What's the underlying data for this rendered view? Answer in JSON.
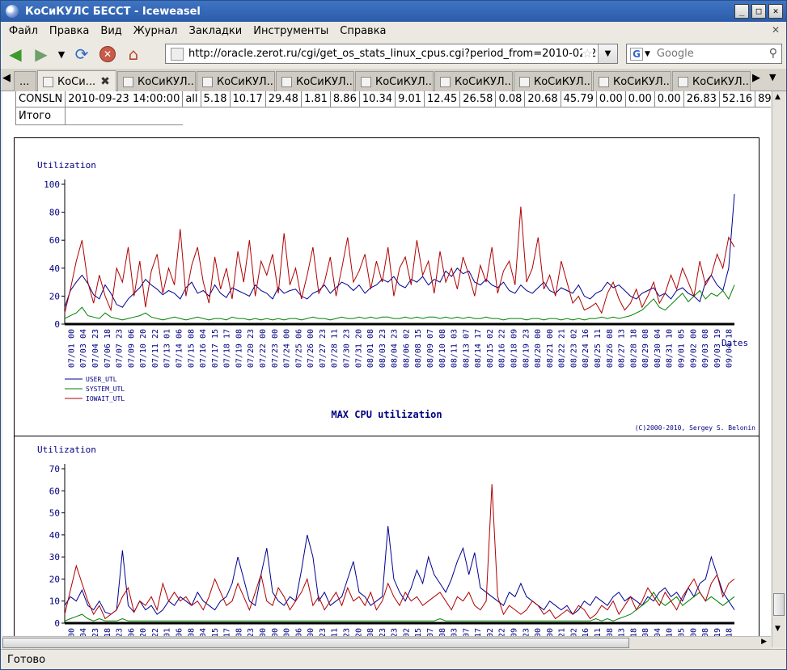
{
  "window": {
    "title": "КоСиКУЛС БЕССТ - Iceweasel",
    "btn_minimize": "_",
    "btn_maximize": "□",
    "btn_close": "✕"
  },
  "menu": [
    "Файл",
    "Правка",
    "Вид",
    "Журнал",
    "Закладки",
    "Инструменты",
    "Справка"
  ],
  "nav": {
    "url": "http://oracle.zerot.ru/cgi/get_os_stats_linux_cpus.cgi?period_from=2010-02-2",
    "search_placeholder": "Google"
  },
  "tabs": [
    {
      "label": "...",
      "active": false
    },
    {
      "label": "КоСи...",
      "active": true
    },
    {
      "label": "КоСиКУЛ...",
      "active": false
    },
    {
      "label": "КоСиКУЛ...",
      "active": false
    },
    {
      "label": "КоСиКУЛ...",
      "active": false
    },
    {
      "label": "КоСиКУЛ...",
      "active": false
    },
    {
      "label": "КоСиКУЛ...",
      "active": false
    },
    {
      "label": "КоСиКУЛ...",
      "active": false
    },
    {
      "label": "КоСиКУЛ...",
      "active": false
    },
    {
      "label": "КоСиКУЛ...",
      "active": false
    }
  ],
  "table": {
    "row": [
      "CONSLN",
      "2010-09-23 14:00:00",
      "all",
      "5.18",
      "10.17",
      "29.48",
      "1.81",
      "8.86",
      "10.34",
      "9.01",
      "12.45",
      "26.58",
      "0.08",
      "20.68",
      "45.79",
      "0.00",
      "0.00",
      "0.00",
      "26.83",
      "52.16",
      "89"
    ],
    "total_label": "Итого"
  },
  "status": "Готово",
  "chart_data": [
    {
      "type": "line",
      "title": "MAX CPU utilization",
      "ylabel": "Utilization",
      "xlabel": "Dates",
      "ylim": [
        0,
        100
      ],
      "yticks": [
        0,
        20,
        40,
        60,
        80,
        100
      ],
      "copyright": "(C)2000-2010, Sergey S. Belonin",
      "x_tick_labels": [
        "07/01 00",
        "07/03 04",
        "07/04 23",
        "07/06 18",
        "07/07 23",
        "07/09 06",
        "07/10 20",
        "07/11 22",
        "07/13 01",
        "07/14 06",
        "07/15 08",
        "07/16 04",
        "07/17 15",
        "07/18 17",
        "07/19 08",
        "07/20 23",
        "07/22 00",
        "07/23 00",
        "07/24 00",
        "07/25 06",
        "07/26 00",
        "07/27 23",
        "07/28 11",
        "07/30 23",
        "07/31 20",
        "08/01 08",
        "08/03 23",
        "08/04 23",
        "08/06 02",
        "08/08 15",
        "08/09 07",
        "08/10 08",
        "08/11 03",
        "08/13 07",
        "08/14 17",
        "08/15 02",
        "08/16 22",
        "08/18 09",
        "08/19 23",
        "08/20 00",
        "08/21 00",
        "08/22 21",
        "08/23 02",
        "08/24 16",
        "08/25 11",
        "08/26 08",
        "08/27 13",
        "08/28 18",
        "08/29 08",
        "08/30 04",
        "08/31 10",
        "09/01 05",
        "09/02 00",
        "09/03 08",
        "09/03 19",
        "09/04 18"
      ],
      "series": [
        {
          "name": "USER_UTL",
          "color": "#000090",
          "values": [
            12,
            24,
            30,
            35,
            29,
            21,
            18,
            28,
            22,
            14,
            12,
            18,
            22,
            26,
            32,
            28,
            25,
            21,
            24,
            22,
            18,
            26,
            30,
            22,
            24,
            20,
            28,
            22,
            19,
            26,
            24,
            22,
            20,
            28,
            24,
            22,
            18,
            26,
            22,
            24,
            25,
            20,
            18,
            22,
            24,
            28,
            22,
            26,
            30,
            28,
            24,
            28,
            22,
            26,
            28,
            32,
            30,
            34,
            28,
            26,
            32,
            30,
            34,
            28,
            32,
            30,
            38,
            34,
            40,
            36,
            38,
            30,
            28,
            32,
            28,
            26,
            30,
            24,
            22,
            28,
            24,
            22,
            26,
            30,
            24,
            22,
            26,
            24,
            22,
            28,
            20,
            18,
            22,
            24,
            30,
            26,
            28,
            24,
            20,
            18,
            22,
            24,
            26,
            20,
            22,
            18,
            24,
            26,
            22,
            20,
            16,
            30,
            35,
            28,
            24,
            40,
            93
          ]
        },
        {
          "name": "SYSTEM_UTL",
          "color": "#008000",
          "values": [
            4,
            6,
            8,
            12,
            6,
            5,
            4,
            8,
            5,
            4,
            3,
            4,
            5,
            6,
            8,
            5,
            4,
            3,
            4,
            5,
            4,
            3,
            4,
            5,
            4,
            3,
            4,
            4,
            3,
            5,
            4,
            4,
            3,
            4,
            3,
            4,
            3,
            4,
            3,
            4,
            4,
            3,
            4,
            5,
            4,
            4,
            3,
            4,
            5,
            4,
            4,
            5,
            4,
            5,
            4,
            5,
            5,
            4,
            4,
            5,
            4,
            5,
            4,
            5,
            5,
            4,
            5,
            4,
            5,
            4,
            5,
            4,
            4,
            5,
            4,
            4,
            3,
            4,
            4,
            4,
            3,
            4,
            4,
            3,
            4,
            4,
            3,
            4,
            3,
            4,
            3,
            4,
            4,
            5,
            4,
            5,
            4,
            5,
            6,
            8,
            10,
            14,
            18,
            12,
            10,
            14,
            18,
            22,
            16,
            20,
            24,
            18,
            22,
            20,
            24,
            18,
            28
          ]
        },
        {
          "name": "IOWAIT_UTL",
          "color": "#b00000",
          "values": [
            8,
            25,
            45,
            60,
            30,
            15,
            35,
            20,
            10,
            40,
            30,
            55,
            20,
            45,
            12,
            38,
            50,
            22,
            40,
            28,
            68,
            20,
            42,
            55,
            30,
            15,
            48,
            25,
            40,
            18,
            52,
            30,
            60,
            20,
            45,
            35,
            50,
            22,
            65,
            28,
            40,
            18,
            35,
            55,
            22,
            30,
            48,
            20,
            40,
            62,
            30,
            38,
            50,
            25,
            45,
            30,
            55,
            20,
            40,
            48,
            28,
            60,
            35,
            45,
            22,
            52,
            30,
            40,
            25,
            48,
            35,
            20,
            42,
            30,
            55,
            22,
            38,
            45,
            28,
            84,
            30,
            40,
            62,
            25,
            35,
            20,
            45,
            30,
            15,
            20,
            10,
            12,
            15,
            8,
            22,
            30,
            18,
            10,
            15,
            25,
            12,
            20,
            30,
            15,
            22,
            35,
            25,
            40,
            30,
            20,
            45,
            28,
            35,
            50,
            40,
            62,
            55
          ]
        }
      ]
    },
    {
      "type": "line",
      "ylabel": "Utilization",
      "ylim": [
        0,
        70
      ],
      "yticks": [
        0,
        10,
        20,
        30,
        40,
        50,
        60,
        70
      ],
      "series": [
        {
          "name": "USER_UTL",
          "color": "#000090",
          "values": [
            8,
            12,
            10,
            15,
            8,
            6,
            10,
            5,
            4,
            6,
            33,
            8,
            5,
            10,
            6,
            8,
            4,
            6,
            10,
            8,
            12,
            10,
            8,
            14,
            10,
            8,
            6,
            10,
            12,
            18,
            30,
            20,
            10,
            8,
            22,
            34,
            14,
            10,
            8,
            12,
            10,
            24,
            40,
            30,
            10,
            14,
            8,
            10,
            12,
            20,
            28,
            14,
            12,
            8,
            10,
            12,
            44,
            20,
            14,
            10,
            16,
            24,
            18,
            30,
            22,
            18,
            14,
            20,
            28,
            34,
            22,
            32,
            16,
            14,
            12,
            10,
            8,
            14,
            12,
            18,
            12,
            10,
            8,
            6,
            10,
            8,
            6,
            8,
            4,
            6,
            10,
            8,
            12,
            10,
            8,
            12,
            14,
            10,
            12,
            10,
            8,
            12,
            10,
            14,
            16,
            12,
            14,
            10,
            16,
            12,
            18,
            20,
            30,
            22,
            14,
            10,
            6
          ]
        },
        {
          "name": "SYSTEM_UTL",
          "color": "#008000",
          "values": [
            1,
            2,
            3,
            4,
            2,
            1,
            2,
            1,
            1,
            1,
            2,
            1,
            1,
            1,
            1,
            1,
            1,
            1,
            1,
            1,
            1,
            1,
            1,
            1,
            1,
            1,
            1,
            1,
            1,
            1,
            1,
            1,
            1,
            1,
            1,
            1,
            1,
            1,
            1,
            1,
            1,
            1,
            1,
            1,
            1,
            1,
            1,
            1,
            1,
            1,
            1,
            1,
            1,
            1,
            1,
            1,
            1,
            1,
            1,
            1,
            1,
            1,
            1,
            1,
            1,
            2,
            1,
            1,
            1,
            1,
            1,
            1,
            1,
            1,
            1,
            1,
            1,
            1,
            1,
            1,
            1,
            1,
            1,
            1,
            1,
            1,
            1,
            1,
            1,
            1,
            1,
            1,
            2,
            1,
            2,
            1,
            2,
            3,
            4,
            6,
            8,
            10,
            14,
            10,
            8,
            10,
            12,
            8,
            10,
            12,
            14,
            10,
            12,
            10,
            8,
            10,
            12
          ]
        },
        {
          "name": "IOWAIT_UTL",
          "color": "#b00000",
          "values": [
            4,
            15,
            26,
            18,
            10,
            4,
            8,
            2,
            4,
            6,
            12,
            16,
            5,
            10,
            8,
            12,
            6,
            18,
            10,
            14,
            10,
            12,
            8,
            10,
            6,
            12,
            20,
            14,
            8,
            10,
            18,
            12,
            6,
            14,
            22,
            10,
            8,
            16,
            12,
            6,
            10,
            14,
            20,
            8,
            12,
            6,
            10,
            14,
            8,
            16,
            10,
            12,
            8,
            14,
            6,
            10,
            18,
            12,
            8,
            14,
            10,
            12,
            8,
            10,
            12,
            14,
            10,
            6,
            12,
            10,
            14,
            8,
            6,
            10,
            63,
            12,
            4,
            8,
            6,
            4,
            6,
            10,
            8,
            4,
            6,
            2,
            4,
            6,
            4,
            8,
            6,
            2,
            4,
            8,
            6,
            10,
            4,
            8,
            12,
            6,
            10,
            16,
            12,
            8,
            14,
            10,
            6,
            12,
            16,
            20,
            14,
            10,
            18,
            22,
            12,
            18,
            20
          ]
        }
      ]
    }
  ]
}
